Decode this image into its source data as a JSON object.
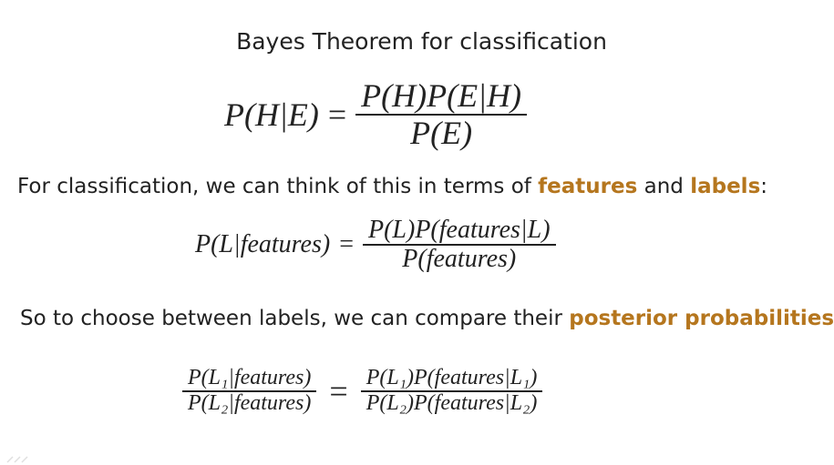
{
  "slide": {
    "title": "Bayes Theorem for classification"
  },
  "formula1": {
    "lhs": "P(H|E)",
    "equals": "=",
    "numerator": "P(H)P(E|H)",
    "denominator": "P(E)"
  },
  "line1": {
    "prefix": "For classification, we can think of this in terms of ",
    "highlight1": "features",
    "middle": " and ",
    "highlight2": "labels",
    "suffix": ":"
  },
  "formula2": {
    "lhs": "P(L|features)",
    "equals": "=",
    "numerator": "P(L)P(features|L)",
    "denominator": "P(features)"
  },
  "line2": {
    "prefix": "So to choose between labels, we can compare their ",
    "highlight": "posterior probabilities",
    "suffix": ":"
  },
  "formula3": {
    "lhs_numerator": "P(L₁|features)",
    "lhs_denominator": "P(L₂|features)",
    "equals": "=",
    "rhs_numerator": "P(L₁)P(features|L₁)",
    "rhs_denominator": "P(L₂)P(features|L₂)"
  },
  "colors": {
    "highlight": "#b5761e",
    "text": "#222222"
  }
}
